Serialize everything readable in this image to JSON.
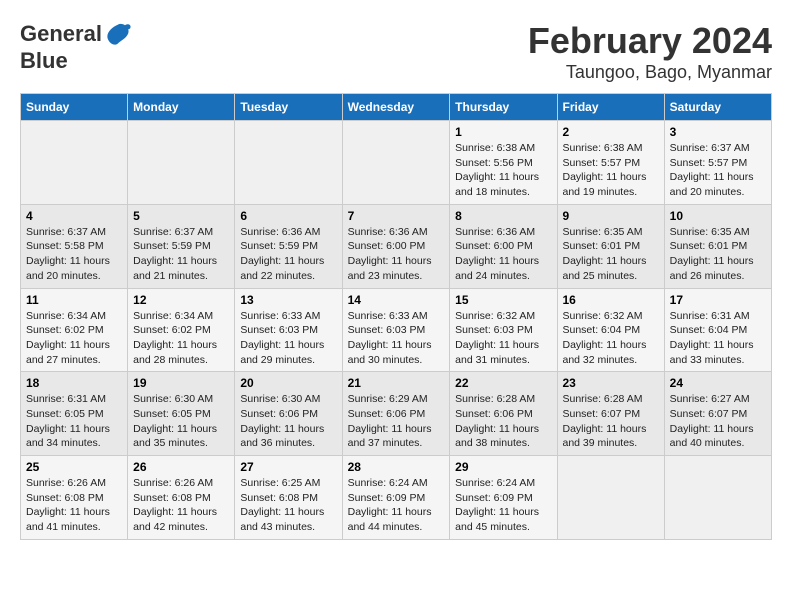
{
  "header": {
    "logo_text_general": "General",
    "logo_text_blue": "Blue",
    "main_title": "February 2024",
    "subtitle": "Taungoo, Bago, Myanmar"
  },
  "calendar": {
    "days_of_week": [
      "Sunday",
      "Monday",
      "Tuesday",
      "Wednesday",
      "Thursday",
      "Friday",
      "Saturday"
    ],
    "weeks": [
      [
        {
          "day": "",
          "info": ""
        },
        {
          "day": "",
          "info": ""
        },
        {
          "day": "",
          "info": ""
        },
        {
          "day": "",
          "info": ""
        },
        {
          "day": "1",
          "info": "Sunrise: 6:38 AM\nSunset: 5:56 PM\nDaylight: 11 hours and 18 minutes."
        },
        {
          "day": "2",
          "info": "Sunrise: 6:38 AM\nSunset: 5:57 PM\nDaylight: 11 hours and 19 minutes."
        },
        {
          "day": "3",
          "info": "Sunrise: 6:37 AM\nSunset: 5:57 PM\nDaylight: 11 hours and 20 minutes."
        }
      ],
      [
        {
          "day": "4",
          "info": "Sunrise: 6:37 AM\nSunset: 5:58 PM\nDaylight: 11 hours and 20 minutes."
        },
        {
          "day": "5",
          "info": "Sunrise: 6:37 AM\nSunset: 5:59 PM\nDaylight: 11 hours and 21 minutes."
        },
        {
          "day": "6",
          "info": "Sunrise: 6:36 AM\nSunset: 5:59 PM\nDaylight: 11 hours and 22 minutes."
        },
        {
          "day": "7",
          "info": "Sunrise: 6:36 AM\nSunset: 6:00 PM\nDaylight: 11 hours and 23 minutes."
        },
        {
          "day": "8",
          "info": "Sunrise: 6:36 AM\nSunset: 6:00 PM\nDaylight: 11 hours and 24 minutes."
        },
        {
          "day": "9",
          "info": "Sunrise: 6:35 AM\nSunset: 6:01 PM\nDaylight: 11 hours and 25 minutes."
        },
        {
          "day": "10",
          "info": "Sunrise: 6:35 AM\nSunset: 6:01 PM\nDaylight: 11 hours and 26 minutes."
        }
      ],
      [
        {
          "day": "11",
          "info": "Sunrise: 6:34 AM\nSunset: 6:02 PM\nDaylight: 11 hours and 27 minutes."
        },
        {
          "day": "12",
          "info": "Sunrise: 6:34 AM\nSunset: 6:02 PM\nDaylight: 11 hours and 28 minutes."
        },
        {
          "day": "13",
          "info": "Sunrise: 6:33 AM\nSunset: 6:03 PM\nDaylight: 11 hours and 29 minutes."
        },
        {
          "day": "14",
          "info": "Sunrise: 6:33 AM\nSunset: 6:03 PM\nDaylight: 11 hours and 30 minutes."
        },
        {
          "day": "15",
          "info": "Sunrise: 6:32 AM\nSunset: 6:03 PM\nDaylight: 11 hours and 31 minutes."
        },
        {
          "day": "16",
          "info": "Sunrise: 6:32 AM\nSunset: 6:04 PM\nDaylight: 11 hours and 32 minutes."
        },
        {
          "day": "17",
          "info": "Sunrise: 6:31 AM\nSunset: 6:04 PM\nDaylight: 11 hours and 33 minutes."
        }
      ],
      [
        {
          "day": "18",
          "info": "Sunrise: 6:31 AM\nSunset: 6:05 PM\nDaylight: 11 hours and 34 minutes."
        },
        {
          "day": "19",
          "info": "Sunrise: 6:30 AM\nSunset: 6:05 PM\nDaylight: 11 hours and 35 minutes."
        },
        {
          "day": "20",
          "info": "Sunrise: 6:30 AM\nSunset: 6:06 PM\nDaylight: 11 hours and 36 minutes."
        },
        {
          "day": "21",
          "info": "Sunrise: 6:29 AM\nSunset: 6:06 PM\nDaylight: 11 hours and 37 minutes."
        },
        {
          "day": "22",
          "info": "Sunrise: 6:28 AM\nSunset: 6:06 PM\nDaylight: 11 hours and 38 minutes."
        },
        {
          "day": "23",
          "info": "Sunrise: 6:28 AM\nSunset: 6:07 PM\nDaylight: 11 hours and 39 minutes."
        },
        {
          "day": "24",
          "info": "Sunrise: 6:27 AM\nSunset: 6:07 PM\nDaylight: 11 hours and 40 minutes."
        }
      ],
      [
        {
          "day": "25",
          "info": "Sunrise: 6:26 AM\nSunset: 6:08 PM\nDaylight: 11 hours and 41 minutes."
        },
        {
          "day": "26",
          "info": "Sunrise: 6:26 AM\nSunset: 6:08 PM\nDaylight: 11 hours and 42 minutes."
        },
        {
          "day": "27",
          "info": "Sunrise: 6:25 AM\nSunset: 6:08 PM\nDaylight: 11 hours and 43 minutes."
        },
        {
          "day": "28",
          "info": "Sunrise: 6:24 AM\nSunset: 6:09 PM\nDaylight: 11 hours and 44 minutes."
        },
        {
          "day": "29",
          "info": "Sunrise: 6:24 AM\nSunset: 6:09 PM\nDaylight: 11 hours and 45 minutes."
        },
        {
          "day": "",
          "info": ""
        },
        {
          "day": "",
          "info": ""
        }
      ]
    ]
  }
}
